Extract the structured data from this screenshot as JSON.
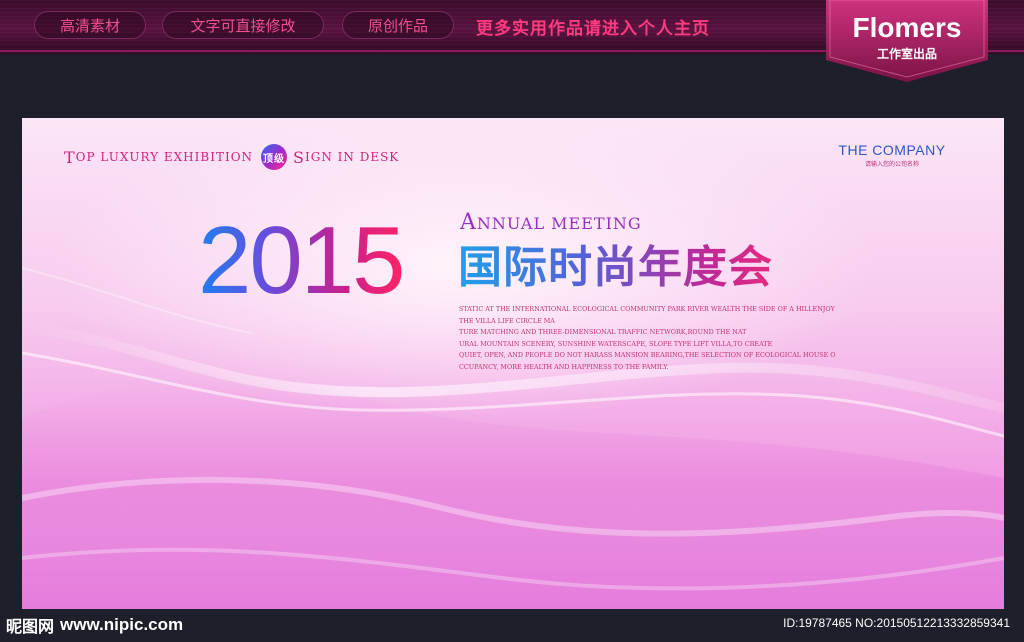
{
  "topbar": {
    "pills": [
      "高清素材",
      "文字可直接修改",
      "原创作品"
    ],
    "promo": "更多实用作品请进入个人主页",
    "badge_brand": "Flomers",
    "badge_sub": "工作室出品"
  },
  "board": {
    "tagline": {
      "t1_initial": "T",
      "t1_rest": "OP LUXURY EXHIBITION",
      "seal": "顶级",
      "t2_initial": "S",
      "t2_rest": "IGN IN DESK"
    },
    "company": {
      "name_a": "THE COMPANY",
      "hint": "请输入您的公司名称"
    },
    "year": "2015",
    "annual": {
      "initial": "A",
      "rest": "NNUAL MEETING"
    },
    "cn_title": "国际时尚年度会",
    "body_lines": [
      "STATIC AT THE INTERNATIONAL ECOLOGICAL COMMUNITY PARK RIVER WEALTH THE SIDE OF A HILLENJOY",
      "THE VILLA LIFE CIRCLE MA",
      "TURE MATCHING AND THREE-DIMENSIONAL TRAFFIC NETWORK,ROUND THE NAT",
      "URAL MOUNTAIN SCENERY, SUNSHINE WATERSCAPE, SLOPE TYPE LIFT VILLA,TO CREATE",
      "QUIET, OPEN, AND PEOPLE DO NOT HARASS MANSION BEARING,THE SELECTION OF ECOLOGICAL HOUSE O",
      "CCUPANCY, MORE HEALTH AND HAPPINESS TO THE FAMILY."
    ]
  },
  "watermark": {
    "site_cn": "昵图网",
    "site_url": "www.nipic.com",
    "id_text": "ID:19787465 NO:20150512213332859341"
  },
  "colors": {
    "accent_pink": "#ff3a7e",
    "badge_bg": "#b0246a",
    "board_pink": "#f09ae2",
    "company_blue": "#2d55c8"
  }
}
